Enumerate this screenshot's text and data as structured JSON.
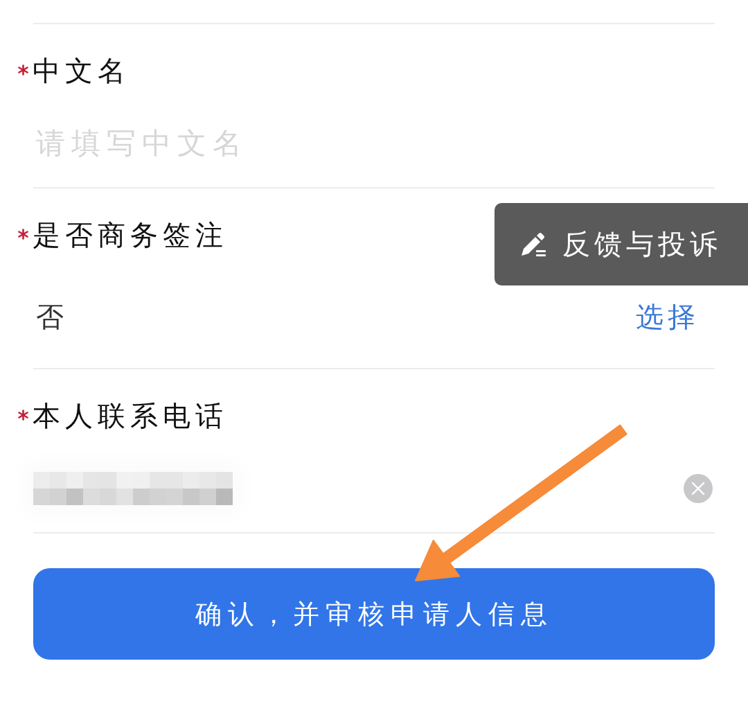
{
  "fields": [
    {
      "kind": "text",
      "label": "中文名",
      "required": true,
      "placeholder": "请填写中文名"
    },
    {
      "kind": "select",
      "label": "是否商务签注",
      "required": true,
      "value": "否",
      "action": "选择"
    },
    {
      "kind": "redacted",
      "label": "本人联系电话",
      "required": true,
      "clearable": true
    }
  ],
  "submit_button": {
    "label": "确认，并审核申请人信息"
  },
  "feedback_button": {
    "label": "反馈与投诉"
  }
}
